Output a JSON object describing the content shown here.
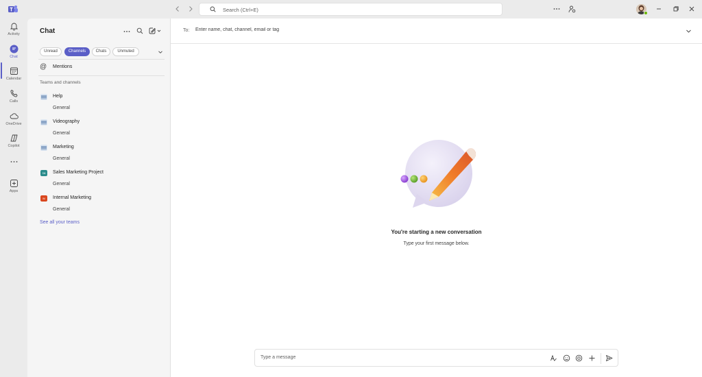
{
  "titlebar": {
    "search_placeholder": "Search (Ctrl+E)"
  },
  "rail": {
    "items": [
      {
        "label": "Activity",
        "icon": "bell-icon"
      },
      {
        "label": "Chat",
        "icon": "chat-icon"
      },
      {
        "label": "Calendar",
        "icon": "calendar-icon"
      },
      {
        "label": "Calls",
        "icon": "phone-icon"
      },
      {
        "label": "OneDrive",
        "icon": "cloud-icon"
      },
      {
        "label": "Copilot",
        "icon": "copilot-icon"
      },
      {
        "label": "Apps",
        "icon": "plus-square-icon"
      }
    ]
  },
  "panel": {
    "title": "Chat",
    "filters": [
      "Unread",
      "Channels",
      "Chats",
      "Unmuted"
    ],
    "active_filter": "Channels",
    "mentions": "Mentions",
    "section_header": "Teams and channels",
    "teams": [
      {
        "name": "Help",
        "channel": "General",
        "logo_color": "#8ea7c8"
      },
      {
        "name": "Videography",
        "channel": "General",
        "logo_color": "#8ea7c8"
      },
      {
        "name": "Marketing",
        "channel": "General",
        "logo_color": "#8ea7c8"
      },
      {
        "name": "Sales Marketing Project",
        "channel": "General",
        "logo_color": "#2a8b8b",
        "initials": "SM"
      },
      {
        "name": "Internal Marketing",
        "channel": "General",
        "logo_color": "#d9471f",
        "initials": "IM"
      }
    ],
    "see_all": "See all your teams"
  },
  "main": {
    "to_label": "To:",
    "to_placeholder": "Enter name, chat, channel, email or tag",
    "empty_heading": "You're starting a new conversation",
    "empty_sub": "Type your first message below.",
    "composer_placeholder": "Type a message"
  },
  "colors": {
    "accent": "#5b5fc7",
    "presence": "#6bb700"
  }
}
